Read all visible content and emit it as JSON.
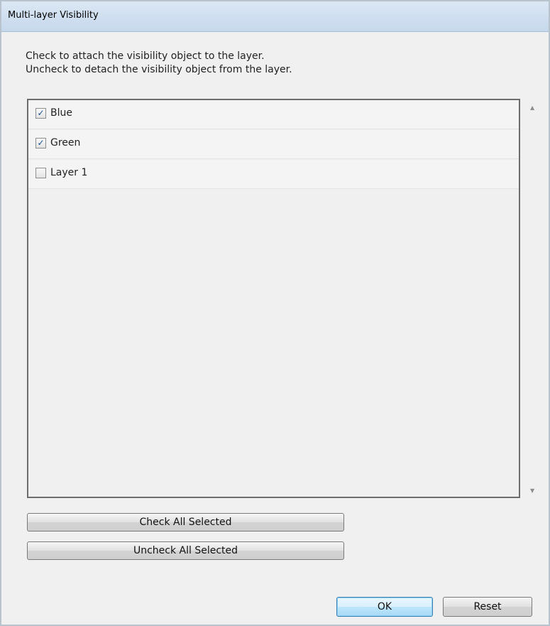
{
  "window": {
    "title": "Multi-layer Visibility"
  },
  "instructions": {
    "line1": "Check to attach the visibility object to the layer.",
    "line2": "Uncheck to detach the visibility object from the layer."
  },
  "layers": [
    {
      "label": "Blue",
      "checked": true
    },
    {
      "label": "Green",
      "checked": true
    },
    {
      "label": "Layer 1",
      "checked": false
    }
  ],
  "buttons": {
    "check_all": "Check All Selected",
    "uncheck_all": "Uncheck All Selected",
    "ok": "OK",
    "reset": "Reset"
  },
  "colors": {
    "titlebar": "#c6d8ec",
    "dialog_background": "#f0f0f0",
    "default_button_border": "#3c7fb1",
    "checkmark": "#1b4d8e"
  }
}
